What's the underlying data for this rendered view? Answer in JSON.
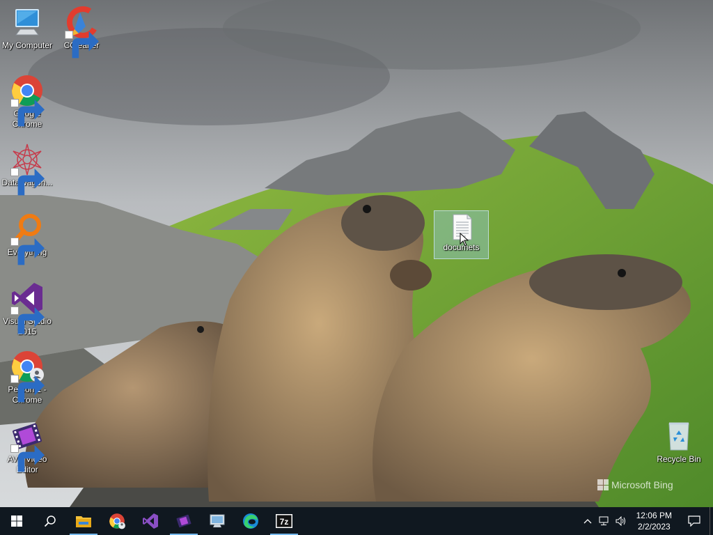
{
  "desktop": {
    "icons": [
      {
        "label": "My Computer",
        "icon": "computer-icon"
      },
      {
        "label": "CCleaner",
        "icon": "ccleaner-icon"
      },
      {
        "label": "Google Chrome",
        "icon": "chrome-icon"
      },
      {
        "label": "DataWagon...",
        "icon": "datawagon-icon"
      },
      {
        "label": "Everything",
        "icon": "everything-search-icon"
      },
      {
        "label": "Visual Studio 2015",
        "icon": "visual-studio-icon"
      },
      {
        "label": "Person 1 - Chrome",
        "icon": "chrome-profile-icon"
      },
      {
        "label": "AVS Video Editor",
        "icon": "avs-video-editor-icon"
      },
      {
        "label": "documets",
        "icon": "text-document-icon",
        "selected": true
      },
      {
        "label": "Recycle Bin",
        "icon": "recycle-bin-icon"
      }
    ],
    "watermark": "Microsoft Bing"
  },
  "taskbar": {
    "pinned": [
      {
        "name": "start",
        "icon": "windows-logo-icon"
      },
      {
        "name": "search",
        "icon": "search-icon"
      },
      {
        "name": "file-explorer",
        "icon": "folder-icon",
        "running": true
      },
      {
        "name": "chrome-profile",
        "icon": "chrome-profile-icon"
      },
      {
        "name": "visual-studio",
        "icon": "visual-studio-icon"
      },
      {
        "name": "avs-video-editor",
        "icon": "avs-video-editor-icon",
        "running": true
      },
      {
        "name": "control-panel",
        "icon": "control-panel-icon"
      },
      {
        "name": "edge",
        "icon": "edge-icon"
      },
      {
        "name": "7zip",
        "icon": "7zip-icon",
        "running": true
      }
    ],
    "tray": {
      "time": "12:06 PM",
      "date": "2/2/2023"
    }
  },
  "colors": {
    "taskbar": "#101820",
    "running_indicator": "#76b9ed",
    "selection": "#99d1ff"
  }
}
